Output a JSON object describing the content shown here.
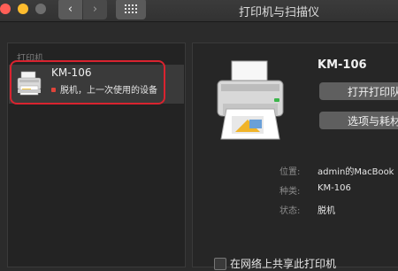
{
  "window": {
    "title": "打印机与扫描仪",
    "back_glyph": "‹",
    "forward_glyph": "›"
  },
  "sidebar": {
    "section_label": "打印机",
    "items": [
      {
        "name": "KM-106",
        "status": "脱机，上一次使用的设备",
        "status_color": "#e0443a",
        "icon": "printer-icon"
      }
    ]
  },
  "detail": {
    "printer_name": "KM-106",
    "queue_button": "打开打印队列",
    "options_button": "选项与耗材",
    "location_label": "位置:",
    "location_value": "admin的MacBook",
    "kind_label": "种类:",
    "kind_value": "KM-106",
    "status_label": "状态:",
    "status_value": "脱机",
    "share_label": "在网络上共享此打印机"
  },
  "colors": {
    "highlight": "#d9232f",
    "close": "#ff5f57",
    "minimize": "#febc2e"
  }
}
